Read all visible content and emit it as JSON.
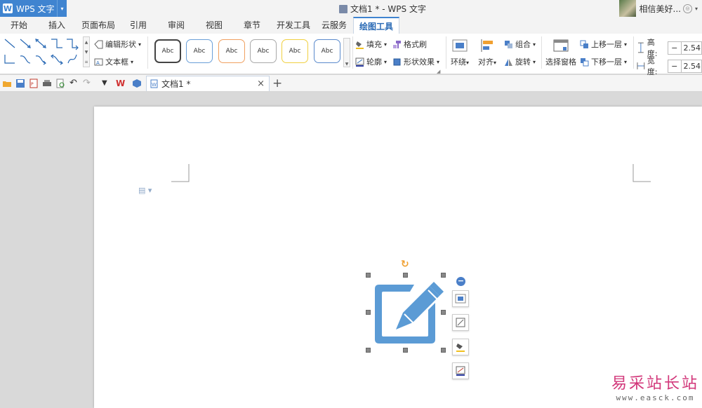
{
  "app": {
    "name": "WPS 文字",
    "logo": "W",
    "window_title": "文档1 * - WPS 文字"
  },
  "user": {
    "name": "相信美好..."
  },
  "menu_tabs": [
    {
      "label": "开始"
    },
    {
      "label": "插入"
    },
    {
      "label": "页面布局"
    },
    {
      "label": "引用"
    },
    {
      "label": "审阅"
    },
    {
      "label": "视图"
    },
    {
      "label": "章节"
    },
    {
      "label": "开发工具"
    },
    {
      "label": "云服务"
    },
    {
      "label": "绘图工具",
      "active": true
    }
  ],
  "ribbon": {
    "edit_shape": "编辑形状",
    "text_box": "文本框",
    "style_swatches": [
      {
        "label": "Abc",
        "border": "#444444"
      },
      {
        "label": "Abc",
        "border": "#6a9fd8"
      },
      {
        "label": "Abc",
        "border": "#f0a060"
      },
      {
        "label": "Abc",
        "border": "#a8a8a8"
      },
      {
        "label": "Abc",
        "border": "#f0d040"
      },
      {
        "label": "Abc",
        "border": "#5a8acc"
      }
    ],
    "fill": "填充",
    "format_painter": "格式刷",
    "outline": "轮廓",
    "shape_effects": "形状效果",
    "wrap": "环绕",
    "align": "对齐",
    "group": "组合",
    "rotate": "旋转",
    "selection_pane": "选择窗格",
    "bring_forward": "上移一层",
    "send_backward": "下移一层",
    "height_label": "高度:",
    "height_value": "2.54",
    "width_label": "宽度:",
    "width_value": "2.54"
  },
  "document_tab": {
    "title": "文档1 *"
  },
  "watermark": {
    "text": "易采站长站",
    "url": "www.easck.com"
  },
  "colors": {
    "accent": "#3f84d0",
    "shape": "#5b9bd5",
    "handle": "#888888"
  }
}
